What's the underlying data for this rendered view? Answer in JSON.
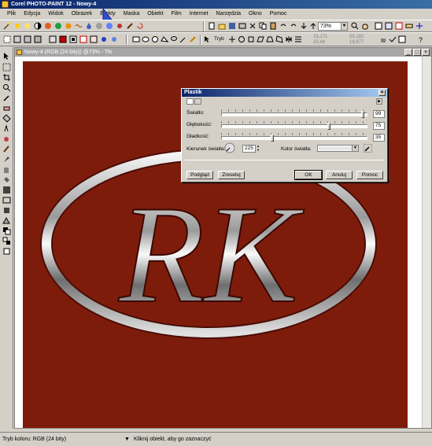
{
  "app": {
    "title": "Corel PHOTO-PAINT 12 - Nowy-4"
  },
  "menu": [
    {
      "label": "Plik"
    },
    {
      "label": "Edycja"
    },
    {
      "label": "Widok"
    },
    {
      "label": "Obrazek"
    },
    {
      "label": "Efekty"
    },
    {
      "label": "Maska"
    },
    {
      "label": "Obiekt"
    },
    {
      "label": "Film"
    },
    {
      "label": "Internet"
    },
    {
      "label": "Narzędzia"
    },
    {
      "label": "Okno"
    },
    {
      "label": "Pomoc"
    }
  ],
  "toolbar": {
    "zoom_value": "73%",
    "mode_label": "Tryb",
    "coords": [
      "16,171",
      "20,48",
      "59,182",
      "18,877"
    ]
  },
  "document": {
    "title": "Nowy-4 (RGB (24 bity)) @73% - Tło",
    "canvas_color": "#7e1c0c",
    "artwork_text": "RK"
  },
  "dialog": {
    "title": "Plastik",
    "light_label": "Światło:",
    "light_value": "99",
    "depth_label": "Głębokość:",
    "depth_value": "75",
    "smooth_label": "Gładkość:",
    "smooth_value": "35",
    "direction_label": "Kierunek światła:",
    "direction_value": "225",
    "color_label": "Kolor światła:",
    "light_color": "#e8e8e8",
    "buttons": {
      "preview": "Podgląd",
      "reset": "Zresetuj",
      "ok": "OK",
      "cancel": "Anuluj",
      "help": "Pomoc"
    }
  },
  "status": {
    "color_mode": "Tryb koloru: RGB (24 bity)",
    "hint": "Kliknij obiekt, aby go zaznaczyć"
  }
}
